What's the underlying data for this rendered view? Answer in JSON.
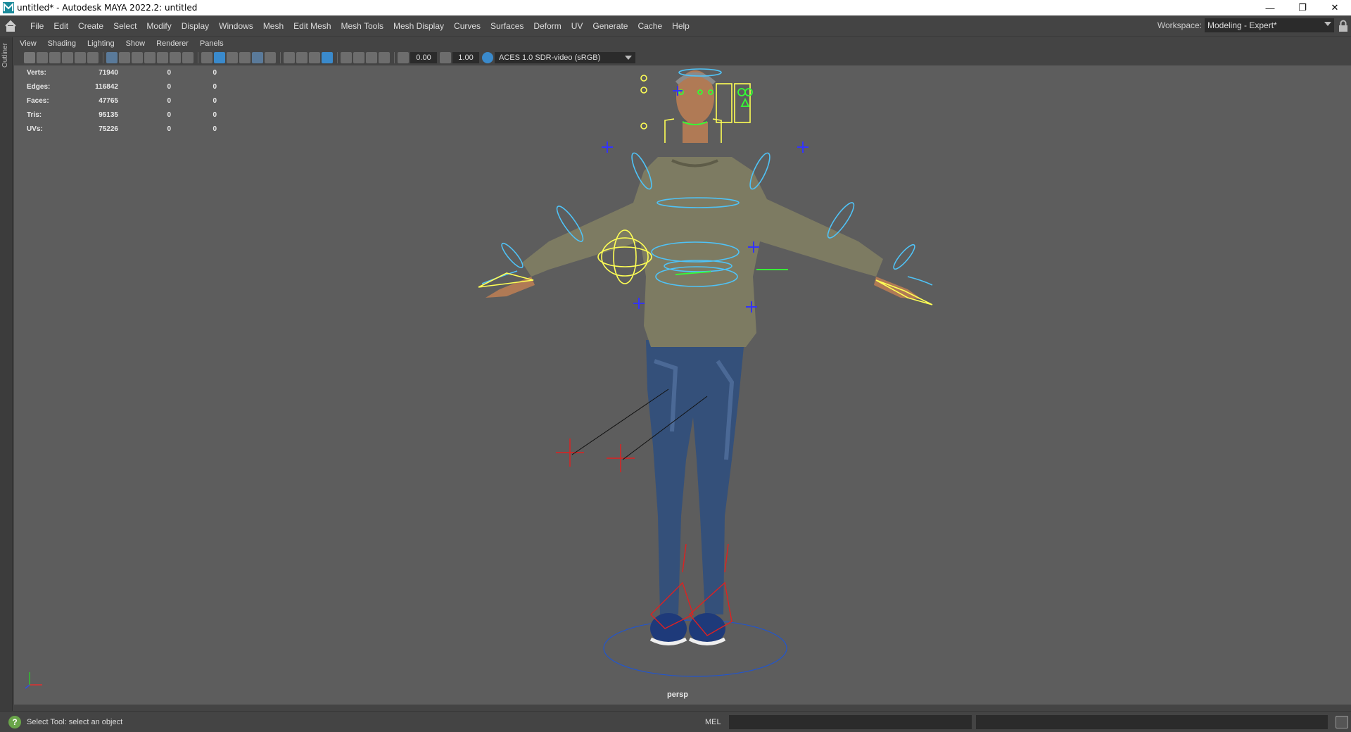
{
  "window": {
    "title": "untitled* - Autodesk MAYA 2022.2: untitled",
    "controls": [
      "minimize-icon",
      "restore-icon",
      "close-icon"
    ]
  },
  "menubar": {
    "items": [
      "File",
      "Edit",
      "Create",
      "Select",
      "Modify",
      "Display",
      "Windows",
      "Mesh",
      "Edit Mesh",
      "Mesh Tools",
      "Mesh Display",
      "Curves",
      "Surfaces",
      "Deform",
      "UV",
      "Generate",
      "Cache",
      "Help"
    ],
    "workspace_label": "Workspace:",
    "workspace_value": "Modeling - Expert*"
  },
  "outliner": {
    "label": "Outliner"
  },
  "panel_menu": {
    "items": [
      "View",
      "Shading",
      "Lighting",
      "Show",
      "Renderer",
      "Panels"
    ]
  },
  "toolbar": {
    "exposure": "0.00",
    "gamma": "1.00",
    "color_space": "ACES 1.0 SDR-video (sRGB)"
  },
  "hud": {
    "rows": [
      {
        "label": "Verts:",
        "value": "71940",
        "sel": "0",
        "comp": "0"
      },
      {
        "label": "Edges:",
        "value": "116842",
        "sel": "0",
        "comp": "0"
      },
      {
        "label": "Faces:",
        "value": "47765",
        "sel": "0",
        "comp": "0"
      },
      {
        "label": "Tris:",
        "value": "95135",
        "sel": "0",
        "comp": "0"
      },
      {
        "label": "UVs:",
        "value": "75226",
        "sel": "0",
        "comp": "0"
      }
    ]
  },
  "viewport": {
    "camera": "persp"
  },
  "statusbar": {
    "message": "Select Tool: select an object",
    "language": "MEL",
    "command_value": ""
  },
  "colors": {
    "viewport_bg": "#5d5d5d",
    "ui_bg": "#444444",
    "control_cyan": "#4fc3f7",
    "control_yellow": "#ffff55",
    "control_green": "#33ff33",
    "control_blue": "#3333ff",
    "control_red": "#e02020"
  }
}
